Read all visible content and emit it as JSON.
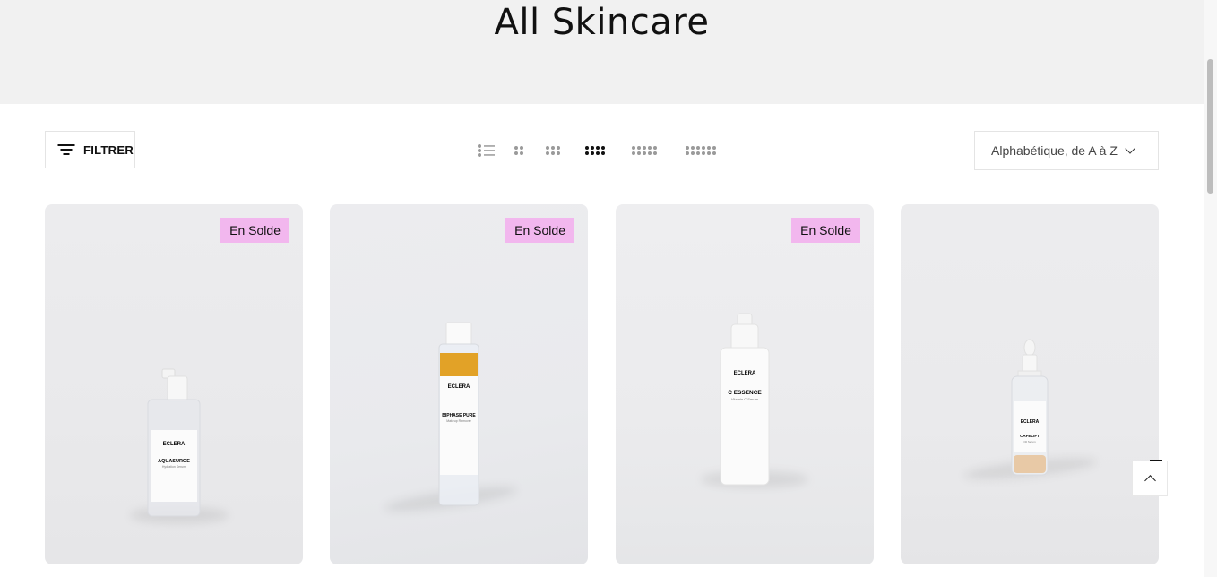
{
  "page": {
    "title": "All Skincare"
  },
  "toolbar": {
    "filter_label": "FILTRER",
    "sort_value": "Alphabétique, de A à Z",
    "view_options": [
      "list",
      "2-columns",
      "3-columns",
      "4-columns",
      "5-columns",
      "6-columns"
    ],
    "active_view": "4-columns"
  },
  "products": [
    {
      "badge": "En Solde",
      "brand": "ECLERA",
      "name": "AQUASURGE",
      "subtitle": "Hydration Serum",
      "type": "pump-bottle"
    },
    {
      "badge": "En Solde",
      "brand": "ECLERA",
      "name": "BIPHASE PURE",
      "subtitle": "Makeup Remover",
      "type": "biphase-bottle"
    },
    {
      "badge": "En Solde",
      "brand": "ECLERA",
      "name": "C ESSENCE",
      "subtitle": "Vitamin C Serum",
      "type": "airless-pump"
    },
    {
      "badge": "",
      "brand": "ECLERA",
      "name": "CAFELIFT",
      "subtitle": "Oil Serum",
      "type": "dropper"
    }
  ],
  "colors": {
    "badge": "#f2b7ee",
    "hero_bg": "#f1f1f1",
    "card_bg": "#ebebed"
  },
  "icons": {
    "filter": "filter-lines-icon",
    "sort": "chevron-down-icon",
    "scroll_top": "arrow-up-icon"
  }
}
